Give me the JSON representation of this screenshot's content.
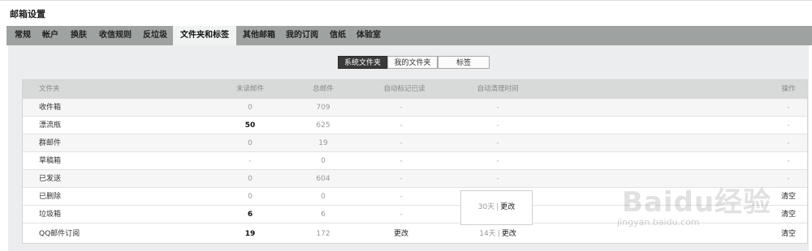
{
  "header": {
    "title": "邮箱设置"
  },
  "tabs": [
    {
      "label": "常规",
      "active": false
    },
    {
      "label": "帐户",
      "active": false
    },
    {
      "label": "换肤",
      "active": false
    },
    {
      "label": "收信规则",
      "active": false
    },
    {
      "label": "反垃圾",
      "active": false
    },
    {
      "label": "文件夹和标签",
      "active": true
    },
    {
      "label": "其他邮箱",
      "active": false
    },
    {
      "label": "我的订阅",
      "active": false
    },
    {
      "label": "信纸",
      "active": false
    },
    {
      "label": "体验室",
      "active": false
    }
  ],
  "segments": [
    {
      "label": "系统文件夹",
      "active": true
    },
    {
      "label": "我的文件夹",
      "active": false
    },
    {
      "label": "标签",
      "active": false
    }
  ],
  "table": {
    "columns": [
      "文件夹",
      "未读邮件",
      "总邮件",
      "自动标记已读",
      "自动清理时间",
      "操作"
    ],
    "rows": [
      {
        "name": "收件箱",
        "unread": "0",
        "total": "709",
        "auto_read": "-",
        "auto_clean": "-",
        "op": "-"
      },
      {
        "name": "漂流瓶",
        "unread": "50",
        "total": "625",
        "auto_read": "-",
        "auto_clean": "-",
        "op": "-"
      },
      {
        "name": "群邮件",
        "unread": "0",
        "total": "19",
        "auto_read": "-",
        "auto_clean": "-",
        "op": "-"
      },
      {
        "name": "草稿箱",
        "unread": "-",
        "total": "0",
        "auto_read": "-",
        "auto_clean": "-",
        "op": "-"
      },
      {
        "name": "已发送",
        "unread": "0",
        "total": "604",
        "auto_read": "-",
        "auto_clean": "-",
        "op": "-"
      },
      {
        "name": "已删除",
        "unread": "0",
        "total": "0",
        "auto_read": "-",
        "auto_clean": "",
        "op": "清空"
      },
      {
        "name": "垃圾箱",
        "unread": "6",
        "total": "6",
        "auto_read": "-",
        "auto_clean": "",
        "op": "清空"
      },
      {
        "name": "QQ邮件订阅",
        "unread": "19",
        "total": "172",
        "auto_read": "更改",
        "auto_clean_days": "14天",
        "auto_clean_change": "更改",
        "op": "清空"
      }
    ],
    "merged_clean": {
      "days": "30天",
      "change": "更改"
    }
  },
  "watermark": {
    "brand": "Baidu经验",
    "url": "jingyan.baidu.com"
  },
  "colors": {
    "tabbar": "#9ea3a1",
    "active_segment": "#3a3a3a",
    "table_header": "#d8d9d9"
  }
}
